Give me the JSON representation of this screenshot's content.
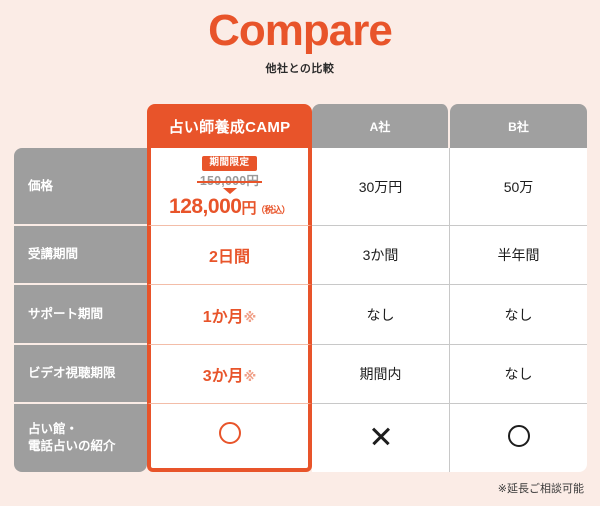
{
  "header": {
    "title": "Compare",
    "subtitle": "他社との比較",
    "accent_color": "#e8542a",
    "background_color": "#fbece6"
  },
  "table": {
    "columns": [
      {
        "id": "label",
        "label": ""
      },
      {
        "id": "camp",
        "label": "占い師養成CAMP",
        "highlight": true
      },
      {
        "id": "a",
        "label": "A社"
      },
      {
        "id": "b",
        "label": "B社"
      }
    ],
    "rows": [
      {
        "label": "価格",
        "camp": {
          "badge": "期間限定",
          "old_price": "150,000円",
          "new_price": "128,000",
          "new_price_unit": "円",
          "tax_note": "（税込）"
        },
        "a": "30万円",
        "b": "50万"
      },
      {
        "label": "受講期間",
        "camp": "2日間",
        "a": "3か間",
        "b": "半年間"
      },
      {
        "label": "サポート期間",
        "camp": "1か月",
        "camp_note": "※",
        "a": "なし",
        "b": "なし"
      },
      {
        "label": "ビデオ視聴期限",
        "camp": "3か月",
        "camp_note": "※",
        "a": "期間内",
        "b": "なし"
      },
      {
        "label_line1": "占い館・",
        "label_line2": "電話占いの紹介",
        "camp_mark": "circle",
        "a_mark": "cross",
        "b_mark": "circle"
      }
    ]
  },
  "footnote": "※延長ご相談可能"
}
